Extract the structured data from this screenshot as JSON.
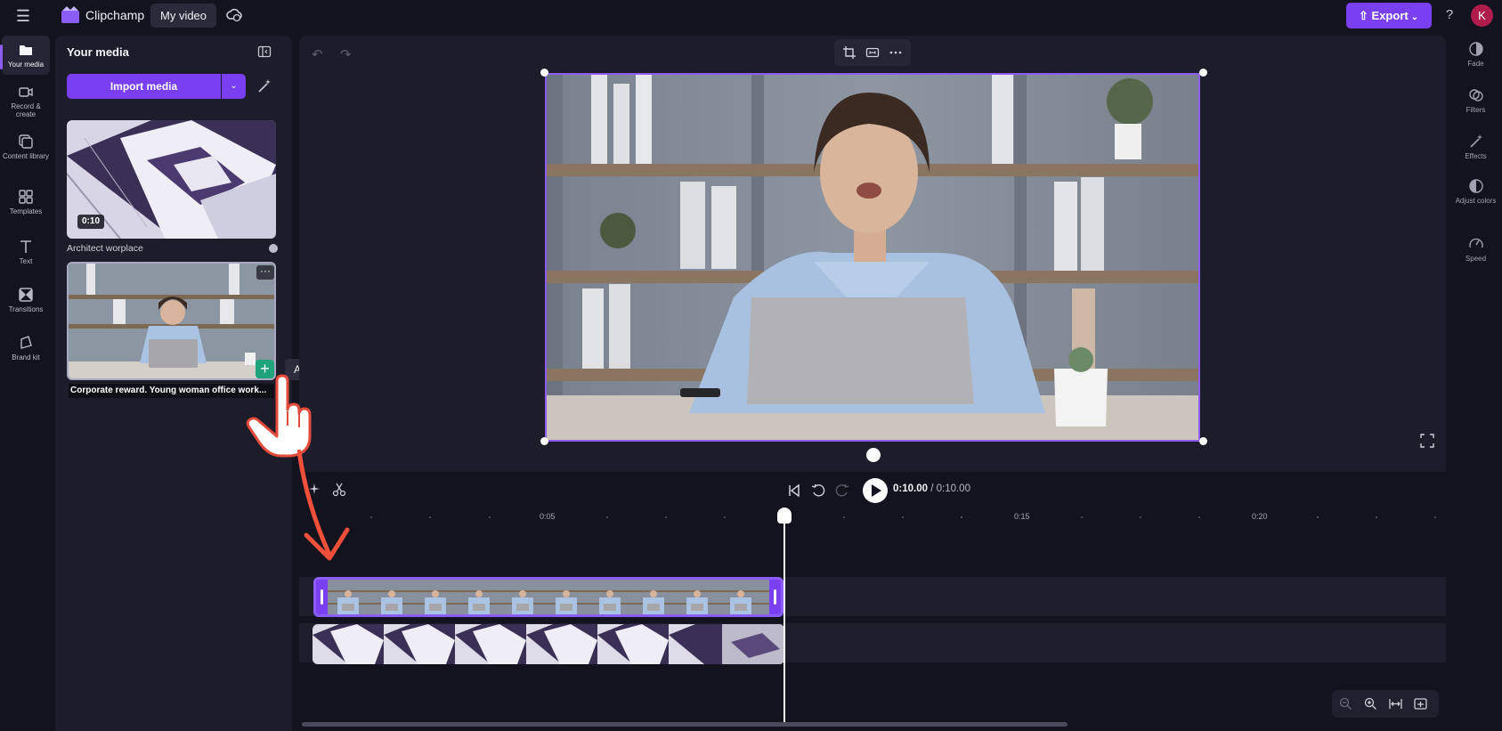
{
  "app": {
    "brand": "Clipchamp",
    "project_title": "My video",
    "export_label": "Export",
    "help_label": "?",
    "avatar_initial": "K",
    "accent_color": "#7b3ff2"
  },
  "left_nav": {
    "items": [
      {
        "label": "Your media",
        "icon": "folder-icon",
        "active": true
      },
      {
        "label": "Record & create",
        "icon": "camera-icon"
      },
      {
        "label": "Content library",
        "icon": "library-icon"
      },
      {
        "label": "Templates",
        "icon": "templates-icon"
      },
      {
        "label": "Text",
        "icon": "text-icon"
      },
      {
        "label": "Transitions",
        "icon": "transitions-icon"
      },
      {
        "label": "Brand kit",
        "icon": "brand-kit-icon"
      }
    ]
  },
  "media_panel": {
    "title": "Your media",
    "import_label": "Import media",
    "assets": [
      {
        "name": "Architect worplace",
        "duration": "0:10"
      },
      {
        "name": "Corporate reward. Young woman office work..."
      }
    ],
    "more_label": "···",
    "add_label": "+",
    "tooltip": "Add to timeline"
  },
  "timeline": {
    "current_time": "0:10.00",
    "separator": " / ",
    "total_time": "0:10.00",
    "ruler_labels": [
      "0:05",
      "0:15",
      "0:20"
    ]
  },
  "right_nav": {
    "items": [
      {
        "label": "Fade",
        "icon": "fade-icon"
      },
      {
        "label": "Filters",
        "icon": "filters-icon"
      },
      {
        "label": "Effects",
        "icon": "effects-icon"
      },
      {
        "label": "Adjust colors",
        "icon": "adjust-colors-icon"
      },
      {
        "label": "Speed",
        "icon": "speed-icon"
      }
    ]
  }
}
